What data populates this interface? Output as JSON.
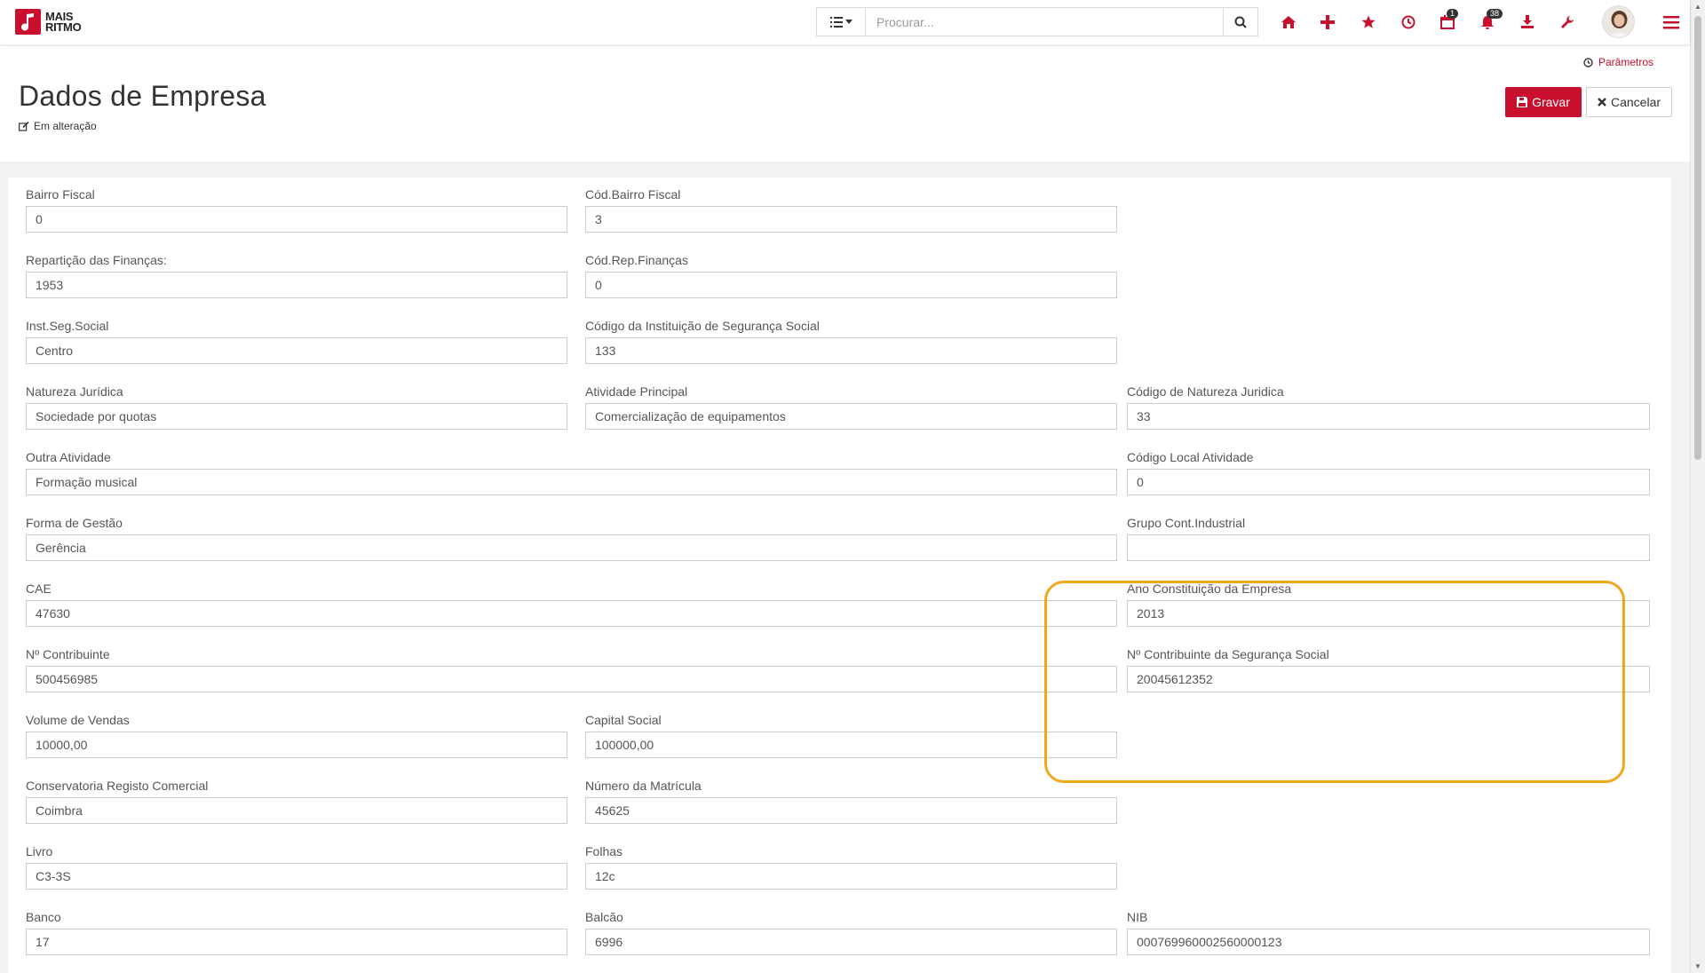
{
  "app": {
    "logo_line1": "MAIS",
    "logo_line2": "RITMO"
  },
  "search": {
    "placeholder": "Procurar...",
    "value": ""
  },
  "toolbar": {
    "icons": [
      "home-icon",
      "plus-icon",
      "star-icon",
      "clock-icon",
      "calendar-icon",
      "bell-icon",
      "download-icon",
      "wrench-icon",
      "avatar",
      "menu-icon"
    ],
    "calendar_badge": "1",
    "bell_badge": "38"
  },
  "header": {
    "params_link": "Parâmetros",
    "title": "Dados de Empresa",
    "status": "Em alteração",
    "save_label": "Gravar",
    "cancel_label": "Cancelar"
  },
  "colors": {
    "accent": "#c8102e",
    "highlight": "#f0a81a"
  },
  "form": {
    "bairro_fiscal": {
      "label": "Bairro Fiscal",
      "value": "0"
    },
    "cod_bairro_fiscal": {
      "label": "Cód.Bairro Fiscal",
      "value": "3"
    },
    "reparticao_financas": {
      "label": "Repartição das Finanças:",
      "value": "1953"
    },
    "cod_rep_financas": {
      "label": "Cód.Rep.Finanças",
      "value": "0"
    },
    "inst_seg_social": {
      "label": "Inst.Seg.Social",
      "value": "Centro"
    },
    "cod_inst_seg_social": {
      "label": "Código da Instituição de Segurança Social",
      "value": "133"
    },
    "natureza_juridica": {
      "label": "Natureza Jurídica",
      "value": "Sociedade por quotas"
    },
    "atividade_principal": {
      "label": "Atividade Principal",
      "value": "Comercialização de equipamentos"
    },
    "cod_natureza_juridica": {
      "label": "Código de Natureza Juridica",
      "value": "33"
    },
    "outra_atividade": {
      "label": "Outra Atividade",
      "value": "Formação musical"
    },
    "cod_local_atividade": {
      "label": "Código Local Atividade",
      "value": "0"
    },
    "forma_gestao": {
      "label": "Forma de Gestão",
      "value": "Gerência"
    },
    "grupo_cont_industrial": {
      "label": "Grupo Cont.Industrial",
      "value": ""
    },
    "cae": {
      "label": "CAE",
      "value": "47630"
    },
    "ano_constituicao": {
      "label": "Ano Constituição da Empresa",
      "value": "2013"
    },
    "n_contribuinte": {
      "label": "Nº Contribuinte",
      "value": "500456985"
    },
    "n_contribuinte_ss": {
      "label": "Nº Contribuinte da Segurança Social",
      "value": "20045612352"
    },
    "volume_vendas": {
      "label": "Volume de Vendas",
      "value": "10000,00"
    },
    "capital_social": {
      "label": "Capital Social",
      "value": "100000,00"
    },
    "conservatoria": {
      "label": "Conservatoria Registo Comercial",
      "value": "Coimbra"
    },
    "numero_matricula": {
      "label": "Número da Matrícula",
      "value": "45625"
    },
    "livro": {
      "label": "Livro",
      "value": "C3-3S"
    },
    "folhas": {
      "label": "Folhas",
      "value": "12c"
    },
    "banco": {
      "label": "Banco",
      "value": "17"
    },
    "balcao": {
      "label": "Balcão",
      "value": "6996"
    },
    "nib": {
      "label": "NIB",
      "value": "000769960002560000123"
    }
  }
}
